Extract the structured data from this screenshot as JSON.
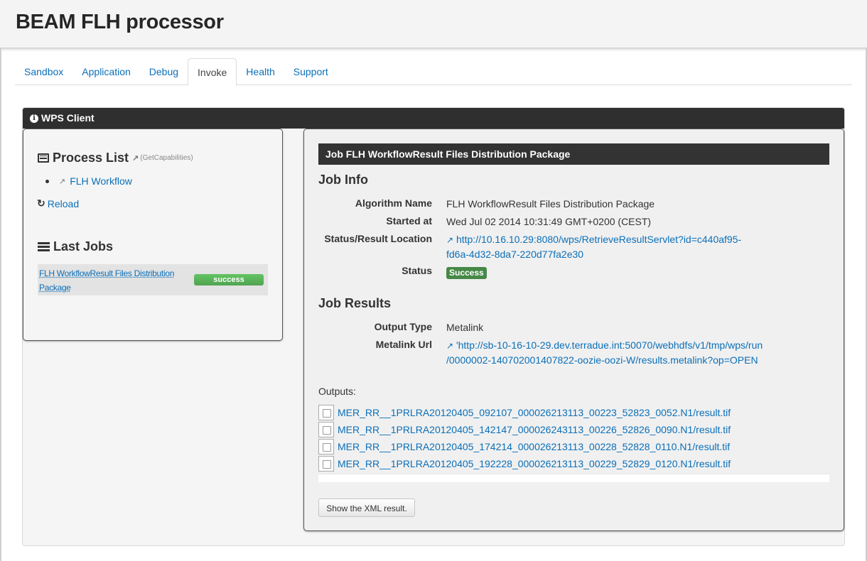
{
  "app": {
    "title": "BEAM FLH processor"
  },
  "tabs": [
    {
      "label": "Sandbox",
      "active": false
    },
    {
      "label": "Application",
      "active": false
    },
    {
      "label": "Debug",
      "active": false
    },
    {
      "label": "Invoke",
      "active": true
    },
    {
      "label": "Health",
      "active": false
    },
    {
      "label": "Support",
      "active": false
    }
  ],
  "panel": {
    "title": "WPS Client",
    "icon": "info-icon"
  },
  "process_list": {
    "title": "Process List",
    "capabilities_label": "(GetCapabilities)",
    "items": [
      {
        "label": "FLH Workflow",
        "icon": "external-link-icon"
      }
    ],
    "reload_label": "Reload"
  },
  "last_jobs": {
    "title": "Last Jobs",
    "items": [
      {
        "name": "FLH WorkflowResult Files Distribution Package",
        "status": "success",
        "status_color": "#5bb75b"
      }
    ]
  },
  "job": {
    "header": "Job FLH WorkflowResult Files Distribution Package",
    "info_title": "Job Info",
    "info": {
      "algorithm_label": "Algorithm Name",
      "algorithm_value": "FLH WorkflowResult Files Distribution Package",
      "started_label": "Started at",
      "started_value": "Wed Jul 02 2014 10:31:49 GMT+0200 (CEST)",
      "location_label": "Status/Result Location",
      "location_value_line1": "http://10.16.10.29:8080/wps/RetrieveResultServlet?id=c440af95-",
      "location_value_line2": "fd6a-4d32-8da7-220d77fa2e30",
      "status_label": "Status",
      "status_value": "Success",
      "status_color": "#468847"
    },
    "results_title": "Job Results",
    "results": {
      "output_type_label": "Output Type",
      "output_type_value": "Metalink",
      "metalink_label": "Metalink Url",
      "metalink_value_line1": "'http://sb-10-16-10-29.dev.terradue.int:50070/webhdfs/v1/tmp/wps/run",
      "metalink_value_line2": "/0000002-140702001407822-oozie-oozi-W/results.metalink?op=OPEN"
    },
    "outputs_label": "Outputs:",
    "outputs": [
      "MER_RR__1PRLRA20120405_092107_000026213113_00223_52823_0052.N1/result.tif",
      "MER_RR__1PRLRA20120405_142147_000026243113_00226_52826_0090.N1/result.tif",
      "MER_RR__1PRLRA20120405_174214_000026213113_00228_52828_0110.N1/result.tif",
      "MER_RR__1PRLRA20120405_192228_000026213113_00229_52829_0120.N1/result.tif"
    ],
    "show_xml_label": "Show the XML result."
  }
}
